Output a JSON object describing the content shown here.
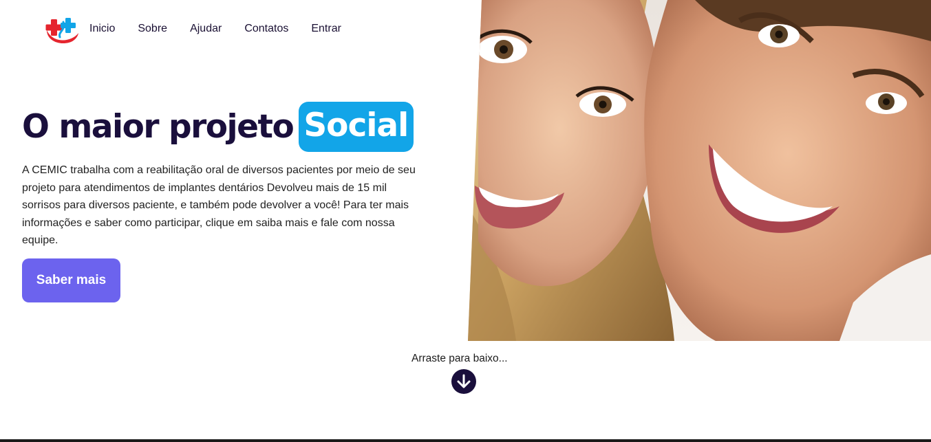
{
  "brand": {
    "logo_icon": "medical-cross-logo-icon",
    "colors": {
      "red": "#e5252e",
      "blue": "#12a5e8"
    }
  },
  "nav": {
    "items": [
      {
        "label": "Inicio"
      },
      {
        "label": "Sobre"
      },
      {
        "label": "Ajudar"
      },
      {
        "label": "Contatos"
      },
      {
        "label": "Entrar"
      }
    ]
  },
  "hero": {
    "title_prefix": "O maior projeto",
    "title_highlight": "Social",
    "description": "A CEMIC trabalha com a reabilitação oral de diversos pacientes por meio de seu projeto para atendimentos de implantes dentários Devolveu mais de 15 mil sorrisos para diversos paciente, e também pode devolver a você! Para ter mais informações e saber como participar, clique em saiba mais e fale com nossa equipe.",
    "cta_label": "Saber mais",
    "accent_color": "#12a5e8",
    "button_color": "#6c63ee",
    "image_subject": "smiling-couple-photo"
  },
  "scroll": {
    "label": "Arraste para baixo...",
    "icon": "arrow-down-circle-icon"
  }
}
